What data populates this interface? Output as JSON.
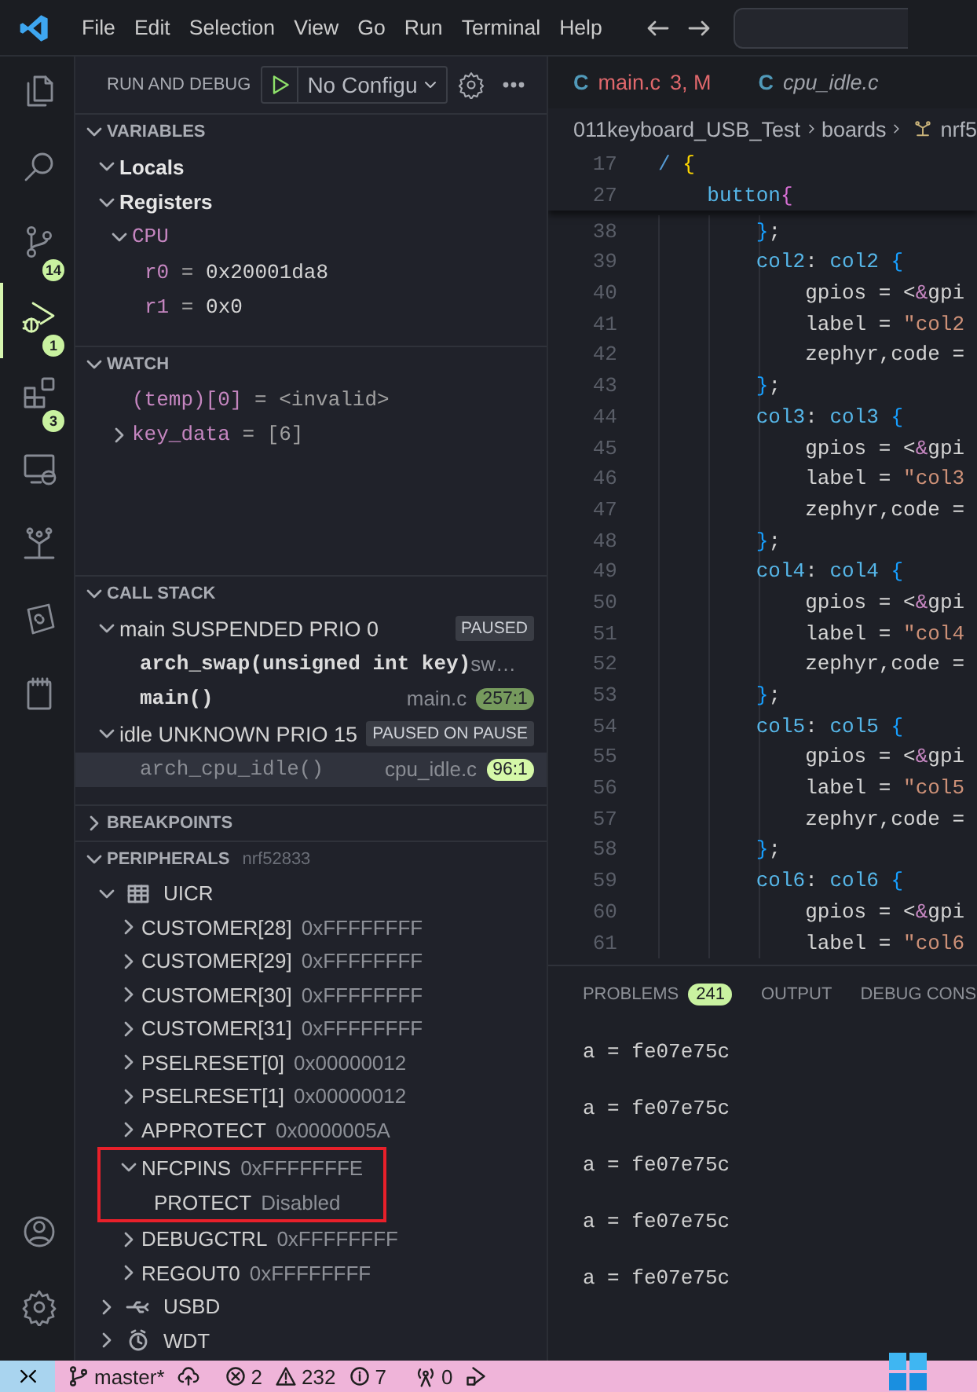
{
  "menu_bar": {
    "items": [
      "File",
      "Edit",
      "Selection",
      "View",
      "Go",
      "Run",
      "Terminal",
      "Help"
    ]
  },
  "activity_bar": {
    "items": [
      {
        "kind": "explorer",
        "selected": false
      },
      {
        "kind": "search",
        "selected": false
      },
      {
        "kind": "source-control",
        "badge": "14",
        "selected": false
      },
      {
        "kind": "run-debug",
        "badge": "1",
        "selected": true
      },
      {
        "kind": "extensions",
        "badge": "3",
        "selected": false
      },
      {
        "kind": "remote",
        "selected": false
      },
      {
        "kind": "tree",
        "selected": false
      },
      {
        "kind": "plugin",
        "selected": false
      },
      {
        "kind": "notebook",
        "selected": false
      }
    ],
    "bottom": [
      {
        "kind": "account"
      },
      {
        "kind": "settings"
      }
    ]
  },
  "sidebar": {
    "title": "RUN AND DEBUG",
    "launch_config": "No Configu",
    "variables": {
      "title": "VARIABLES",
      "expanded": true,
      "items": [
        {
          "name": "Locals",
          "expanded": true
        },
        {
          "name": "Registers",
          "expanded": true,
          "children": [
            {
              "name": "CPU",
              "expanded": true,
              "children": [
                {
                  "name": "r0",
                  "separator": "=",
                  "value": "0x20001da8"
                },
                {
                  "name": "r1",
                  "separator": "=",
                  "value": "0x0"
                }
              ]
            }
          ]
        }
      ]
    },
    "watch": {
      "title": "WATCH",
      "expanded": true,
      "items": [
        {
          "expression": "(temp)[0]",
          "separator": "=",
          "value": "<invalid>"
        },
        {
          "expression": "key_data",
          "separator": "=",
          "value": "[6]",
          "expanded": false
        }
      ]
    },
    "call_stack": {
      "title": "CALL STACK",
      "expanded": true,
      "threads": [
        {
          "name": "main SUSPENDED PRIO 0",
          "status": "PAUSED",
          "expanded": true,
          "frames": [
            {
              "function": "arch_swap(unsigned int key)",
              "file": "sw…",
              "dimmed": false,
              "selected": false
            },
            {
              "function": "main()",
              "file": "main.c",
              "position": "257:1",
              "dimmed": false,
              "selected": false
            }
          ]
        },
        {
          "name": "idle UNKNOWN PRIO 15",
          "status": "PAUSED ON PAUSE",
          "expanded": true,
          "frames": [
            {
              "function": "arch_cpu_idle()",
              "file": "cpu_idle.c",
              "position": "96:1",
              "dimmed": true,
              "selected": true
            }
          ]
        }
      ]
    },
    "breakpoints": {
      "title": "BREAKPOINTS",
      "expanded": false
    },
    "peripherals": {
      "title": "PERIPHERALS",
      "device": "nrf52833",
      "expanded": true,
      "items": [
        {
          "name": "UICR",
          "expanded": true,
          "children": [
            {
              "name": "CUSTOMER[28]",
              "value": "0xFFFFFFFF",
              "expanded": false,
              "highlighted": false
            },
            {
              "name": "CUSTOMER[29]",
              "value": "0xFFFFFFFF",
              "expanded": false,
              "highlighted": false
            },
            {
              "name": "CUSTOMER[30]",
              "value": "0xFFFFFFFF",
              "expanded": false,
              "highlighted": false
            },
            {
              "name": "CUSTOMER[31]",
              "value": "0xFFFFFFFF",
              "expanded": false,
              "highlighted": false
            },
            {
              "name": "PSELRESET[0]",
              "value": "0x00000012",
              "expanded": false,
              "highlighted": false
            },
            {
              "name": "PSELRESET[1]",
              "value": "0x00000012",
              "expanded": false,
              "highlighted": false
            },
            {
              "name": "APPROTECT",
              "value": "0x0000005A",
              "expanded": false,
              "highlighted": false
            },
            {
              "name": "NFCPINS",
              "value": "0xFFFFFFFE",
              "expanded": true,
              "highlighted": true,
              "children": [
                {
                  "name": "PROTECT",
                  "value": "Disabled"
                }
              ]
            },
            {
              "name": "DEBUGCTRL",
              "value": "0xFFFFFFFF",
              "expanded": false,
              "highlighted": false
            },
            {
              "name": "REGOUT0",
              "value": "0xFFFFFFFF",
              "expanded": false,
              "highlighted": false
            }
          ]
        },
        {
          "name": "USBD",
          "expanded": false
        },
        {
          "name": "WDT",
          "expanded": false
        }
      ]
    }
  },
  "editor": {
    "tabs": [
      {
        "icon": "C",
        "name": "main.c",
        "status": "3, M",
        "preview": false
      },
      {
        "icon": "C",
        "name": "cpu_idle.c",
        "preview": true
      }
    ],
    "breadcrumb": [
      "011keyboard_USB_Test",
      "boards",
      "nrf5"
    ],
    "sticky_lines": [
      {
        "number": "17",
        "text": "/ {"
      },
      {
        "number": "27",
        "text": "    button{"
      }
    ],
    "lines": [
      {
        "number": "38",
        "text": "        };"
      },
      {
        "number": "39",
        "text": "        col2: col2 {"
      },
      {
        "number": "40",
        "text": "            gpios = <&gpi"
      },
      {
        "number": "41",
        "text": "            label = \"col2"
      },
      {
        "number": "42",
        "text": "            zephyr,code ="
      },
      {
        "number": "43",
        "text": "        };"
      },
      {
        "number": "44",
        "text": "        col3: col3 {"
      },
      {
        "number": "45",
        "text": "            gpios = <&gpi"
      },
      {
        "number": "46",
        "text": "            label = \"col3"
      },
      {
        "number": "47",
        "text": "            zephyr,code ="
      },
      {
        "number": "48",
        "text": "        };"
      },
      {
        "number": "49",
        "text": "        col4: col4 {"
      },
      {
        "number": "50",
        "text": "            gpios = <&gpi"
      },
      {
        "number": "51",
        "text": "            label = \"col4"
      },
      {
        "number": "52",
        "text": "            zephyr,code ="
      },
      {
        "number": "53",
        "text": "        };"
      },
      {
        "number": "54",
        "text": "        col5: col5 {"
      },
      {
        "number": "55",
        "text": "            gpios = <&gpi"
      },
      {
        "number": "56",
        "text": "            label = \"col5"
      },
      {
        "number": "57",
        "text": "            zephyr,code ="
      },
      {
        "number": "58",
        "text": "        };"
      },
      {
        "number": "59",
        "text": "        col6: col6 {"
      },
      {
        "number": "60",
        "text": "            gpios = <&gpi"
      },
      {
        "number": "61",
        "text": "            label = \"col6"
      }
    ]
  },
  "panel": {
    "tabs": [
      {
        "label": "PROBLEMS",
        "badge": "241"
      },
      {
        "label": "OUTPUT"
      },
      {
        "label": "DEBUG CONS"
      }
    ],
    "output": [
      "a = fe07e75c",
      "a = fe07e75c",
      "a = fe07e75c",
      "a = fe07e75c",
      "a = fe07e75c"
    ]
  },
  "status_bar": {
    "items": [
      {
        "kind": "remote"
      },
      {
        "kind": "branch",
        "text": "master*"
      },
      {
        "kind": "sync"
      },
      {
        "kind": "errors",
        "text": "2"
      },
      {
        "kind": "warnings",
        "text": "232"
      },
      {
        "kind": "info",
        "text": "7"
      },
      {
        "kind": "ports",
        "text": "0"
      },
      {
        "kind": "debug"
      }
    ]
  }
}
